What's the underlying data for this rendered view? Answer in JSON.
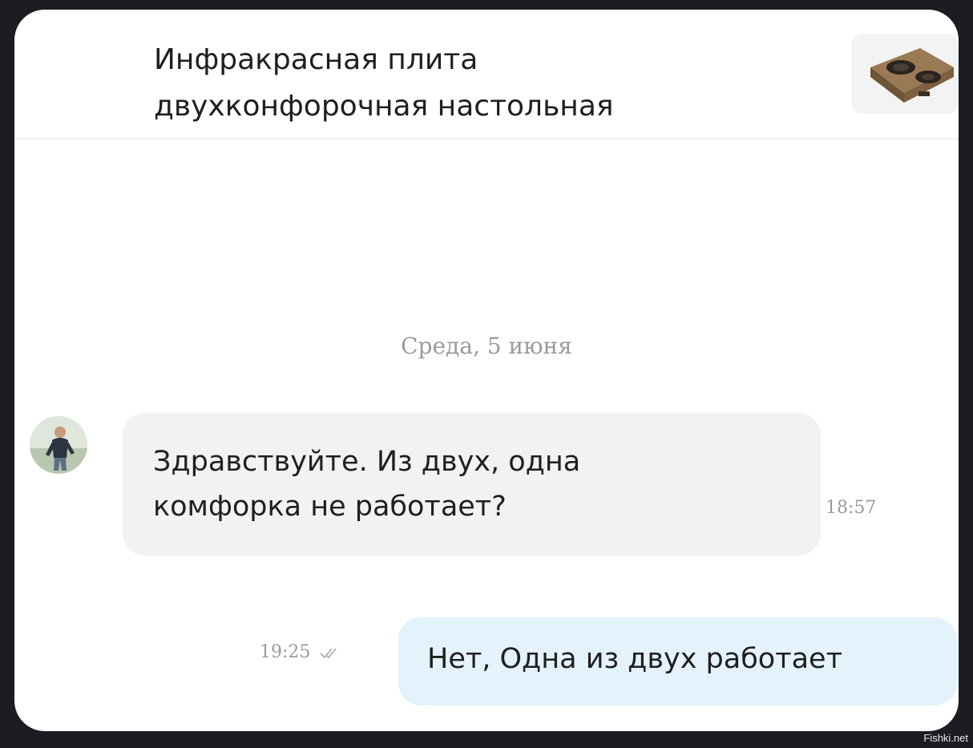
{
  "chat": {
    "header": {
      "product_title": "Инфракрасная плита\nдвухконфорочная настольная",
      "product_thumb_icon": "stove-thumbnail-icon"
    },
    "date_separator": "Среда, 5 июня",
    "messages": [
      {
        "direction": "incoming",
        "text": "Здравствуйте. Из двух, одна\nкомфорка не работает?",
        "time": "18:57"
      },
      {
        "direction": "outgoing",
        "text": "Нет, Одна из двух работает",
        "time": "19:25",
        "status_icon": "double-check-icon"
      }
    ]
  },
  "watermark": "Fishki.net",
  "colors": {
    "background": "#1b1d22",
    "card": "#ffffff",
    "incoming_bubble": "#f2f2f2",
    "outgoing_bubble": "#e3f2fb",
    "muted_text": "#9a9a9a"
  }
}
